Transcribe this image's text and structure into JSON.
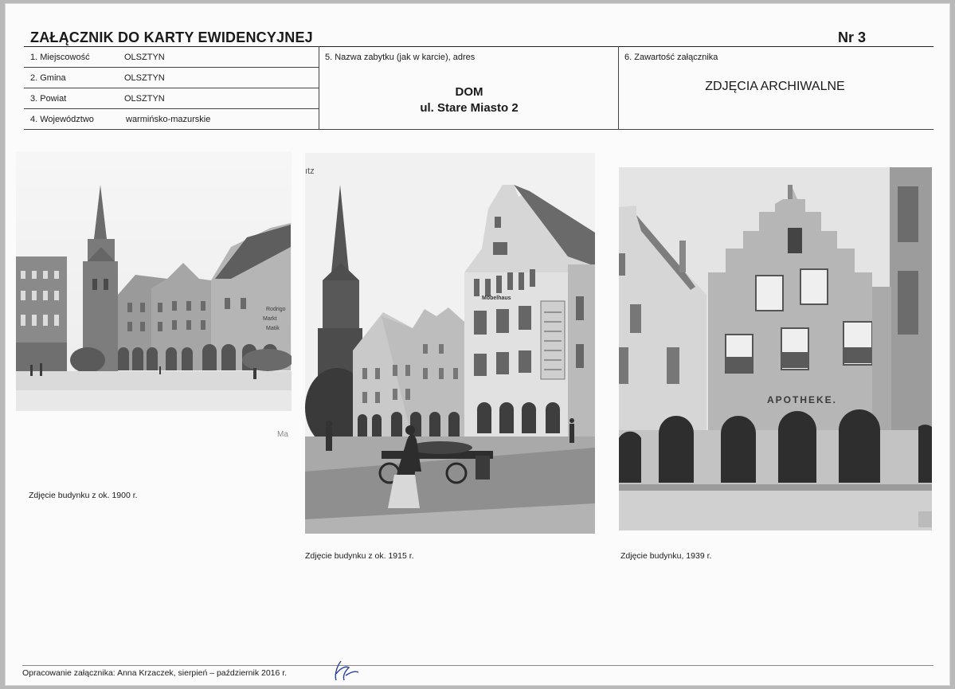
{
  "header": {
    "title": "ZAŁĄCZNIK DO KARTY EWIDENCYJNEJ",
    "number": "Nr 3"
  },
  "location": {
    "rows": [
      {
        "label": "1. Miejscowość",
        "value": "OLSZTYN"
      },
      {
        "label": "2. Gmina",
        "value": "OLSZTYN"
      },
      {
        "label": "3. Powiat",
        "value": "OLSZTYN"
      },
      {
        "label": "4. Województwo",
        "value": "warmińsko-mazurskie"
      }
    ]
  },
  "monument": {
    "label": "5. Nazwa zabytku (jak w karcie), adres",
    "name": "DOM",
    "address": "ul. Stare Miasto 2"
  },
  "attachment": {
    "label": "6. Zawartość załącznika",
    "value": "ZDJĘCIA ARCHIWALNE"
  },
  "photos": [
    {
      "caption": "Zdjęcie budynku z ok. 1900 r.",
      "corner_text": "Ma",
      "signs": [
        "Rodrigo",
        "Markt",
        "Matik"
      ]
    },
    {
      "caption": "Zdjęcie budynku z ok. 1915 r.",
      "corner_text": "ıtz",
      "signs": [
        "Möbelhaus"
      ]
    },
    {
      "caption": "Zdjęcie budynku, 1939 r.",
      "signs": [
        "APOTHEKE."
      ]
    }
  ],
  "footer": {
    "text": "Opracowanie załącznika: Anna Krzaczek, sierpień – październik 2016 r."
  }
}
